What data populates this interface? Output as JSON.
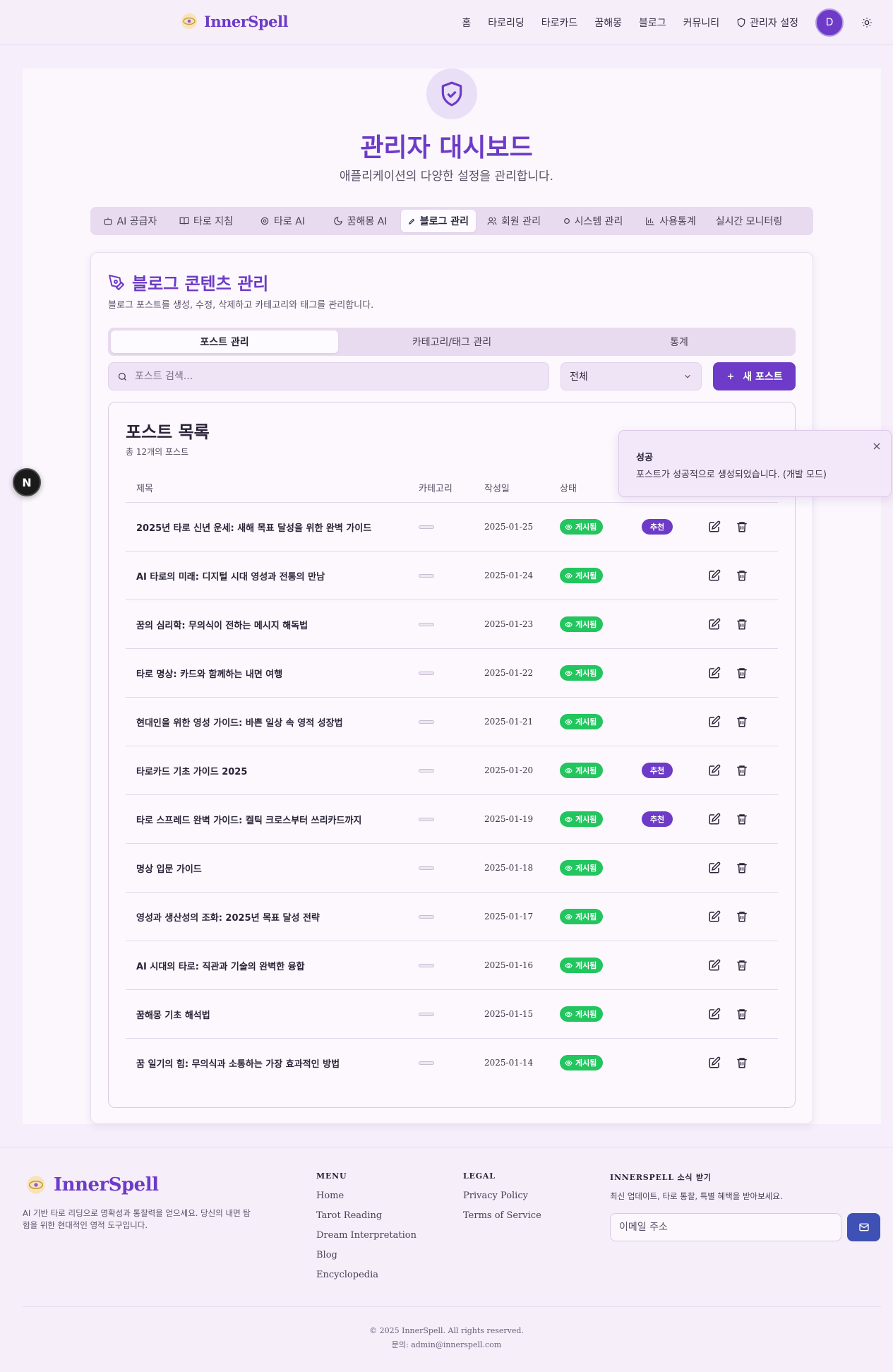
{
  "header": {
    "brand": "InnerSpell",
    "nav": [
      "홈",
      "타로리딩",
      "타로카드",
      "꿈해몽",
      "블로그",
      "커뮤니티"
    ],
    "admin_settings": "관리자 설정",
    "avatar_initial": "D"
  },
  "page": {
    "title": "관리자 대시보드",
    "subtitle": "애플리케이션의 다양한 설정을 관리합니다."
  },
  "admin_tabs": [
    {
      "label": "AI 공급자",
      "icon": "bot-icon"
    },
    {
      "label": "타로 지침",
      "icon": "book-icon"
    },
    {
      "label": "타로 AI",
      "icon": "cog-icon"
    },
    {
      "label": "꿈해몽 AI",
      "icon": "moon-icon"
    },
    {
      "label": "블로그 관리",
      "icon": "pen-icon",
      "active": true
    },
    {
      "label": "회원 관리",
      "icon": "users-icon"
    },
    {
      "label": "시스템 관리",
      "icon": "circle-icon"
    },
    {
      "label": "사용통계",
      "icon": "chart-icon"
    },
    {
      "label": "실시간 모니터링",
      "icon": ""
    }
  ],
  "blog": {
    "title": "블로그 콘텐츠 관리",
    "description": "블로그 포스트를 생성, 수정, 삭제하고 카테고리와 태그를 관리합니다.",
    "sub_tabs": [
      "포스트 관리",
      "카테고리/태그 관리",
      "통계"
    ],
    "search_placeholder": "포스트 검색...",
    "filter_value": "전체",
    "new_post_label": "새 포스트",
    "list_title": "포스트 목록",
    "list_count": "총 12개의 포스트",
    "columns": {
      "title": "제목",
      "category": "카테고리",
      "date": "작성일",
      "status": "상태"
    },
    "posts": [
      {
        "title": "2025년 타로 신년 운세: 새해 목표 달성을 위한 완벽 가이드",
        "date": "2025-01-25",
        "status": "게시됨",
        "featured": "추천"
      },
      {
        "title": "AI 타로의 미래: 디지털 시대 영성과 전통의 만남",
        "date": "2025-01-24",
        "status": "게시됨",
        "featured": ""
      },
      {
        "title": "꿈의 심리학: 무의식이 전하는 메시지 해독법",
        "date": "2025-01-23",
        "status": "게시됨",
        "featured": ""
      },
      {
        "title": "타로 명상: 카드와 함께하는 내면 여행",
        "date": "2025-01-22",
        "status": "게시됨",
        "featured": ""
      },
      {
        "title": "현대인을 위한 영성 가이드: 바쁜 일상 속 영적 성장법",
        "date": "2025-01-21",
        "status": "게시됨",
        "featured": ""
      },
      {
        "title": "타로카드 기초 가이드 2025",
        "date": "2025-01-20",
        "status": "게시됨",
        "featured": "추천"
      },
      {
        "title": "타로 스프레드 완벽 가이드: 켈틱 크로스부터 쓰리카드까지",
        "date": "2025-01-19",
        "status": "게시됨",
        "featured": "추천"
      },
      {
        "title": "명상 입문 가이드",
        "date": "2025-01-18",
        "status": "게시됨",
        "featured": ""
      },
      {
        "title": "영성과 생산성의 조화: 2025년 목표 달성 전략",
        "date": "2025-01-17",
        "status": "게시됨",
        "featured": ""
      },
      {
        "title": "AI 시대의 타로: 직관과 기술의 완벽한 융합",
        "date": "2025-01-16",
        "status": "게시됨",
        "featured": ""
      },
      {
        "title": "꿈해몽 기초 해석법",
        "date": "2025-01-15",
        "status": "게시됨",
        "featured": ""
      },
      {
        "title": "꿈 일기의 힘: 무의식과 소통하는 가장 효과적인 방법",
        "date": "2025-01-14",
        "status": "게시됨",
        "featured": ""
      }
    ]
  },
  "toast": {
    "title": "성공",
    "message": "포스트가 성공적으로 생성되었습니다. (개발 모드)"
  },
  "dev_badge": "N",
  "footer": {
    "brand": "InnerSpell",
    "tagline": "AI 기반 타로 리딩으로 명확성과 통찰력을 얻으세요. 당신의 내면 탐험을 위한 현대적인 영적 도구입니다.",
    "menu_heading": "MENU",
    "menu": [
      "Home",
      "Tarot Reading",
      "Dream Interpretation",
      "Blog",
      "Encyclopedia"
    ],
    "legal_heading": "LEGAL",
    "legal": [
      "Privacy Policy",
      "Terms of Service"
    ],
    "newsletter_heading": "INNERSPELL 소식 받기",
    "newsletter_desc": "최신 업데이트, 타로 통찰, 특별 혜택을 받아보세요.",
    "email_placeholder": "이메일 주소",
    "copyright": "© 2025 InnerSpell. All rights reserved.",
    "contact": "문의: admin@innerspell.com"
  },
  "colors": {
    "accent": "#6d3bc7",
    "status_published": "#22c55e",
    "send_button": "#3f51b5"
  }
}
